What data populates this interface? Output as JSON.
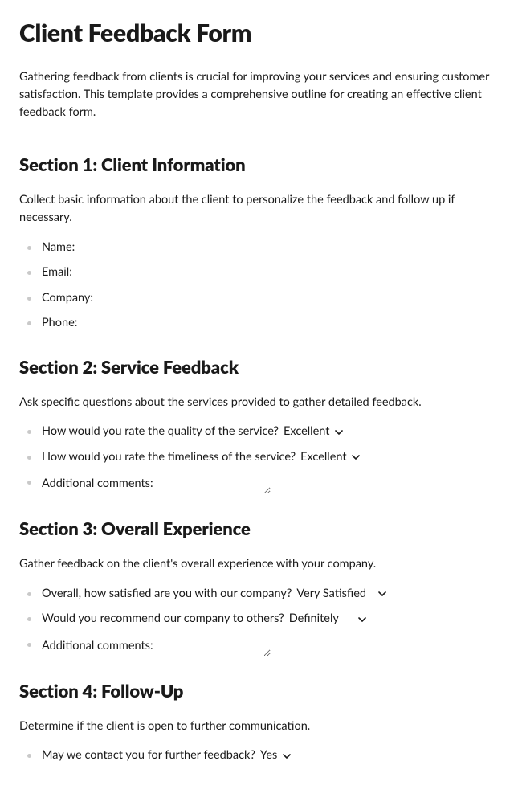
{
  "title": "Client Feedback Form",
  "intro": "Gathering feedback from clients is crucial for improving your services and ensuring customer satisfaction. This template provides a comprehensive outline for creating an effective client feedback form.",
  "sections": {
    "s1": {
      "heading": "Section 1: Client Information",
      "desc": "Collect basic information about the client to personalize the feedback and follow up if necessary.",
      "fields": {
        "name": "Name:",
        "email": "Email:",
        "company": "Company:",
        "phone": "Phone:"
      }
    },
    "s2": {
      "heading": "Section 2: Service Feedback",
      "desc": "Ask specific questions about the services provided to gather detailed feedback.",
      "q_quality": "How would you rate the quality of the service?",
      "q_timeliness": "How would you rate the timeliness of the service?",
      "val_quality": "Excellent",
      "val_timeliness": "Excellent",
      "comments_label": "Additional comments:"
    },
    "s3": {
      "heading": "Section 3: Overall Experience",
      "desc": "Gather feedback on the client's overall experience with your company.",
      "q_satisfied": "Overall, how satisfied are you with our company?",
      "q_recommend": "Would you recommend our company to others?",
      "val_satisfied": "Very Satisfied",
      "val_recommend": "Definitely",
      "comments_label": "Additional comments:"
    },
    "s4": {
      "heading": "Section 4: Follow-Up",
      "desc": "Determine if the client is open to further communication.",
      "q_contact": "May we contact you for further feedback?",
      "val_contact": "Yes"
    }
  }
}
